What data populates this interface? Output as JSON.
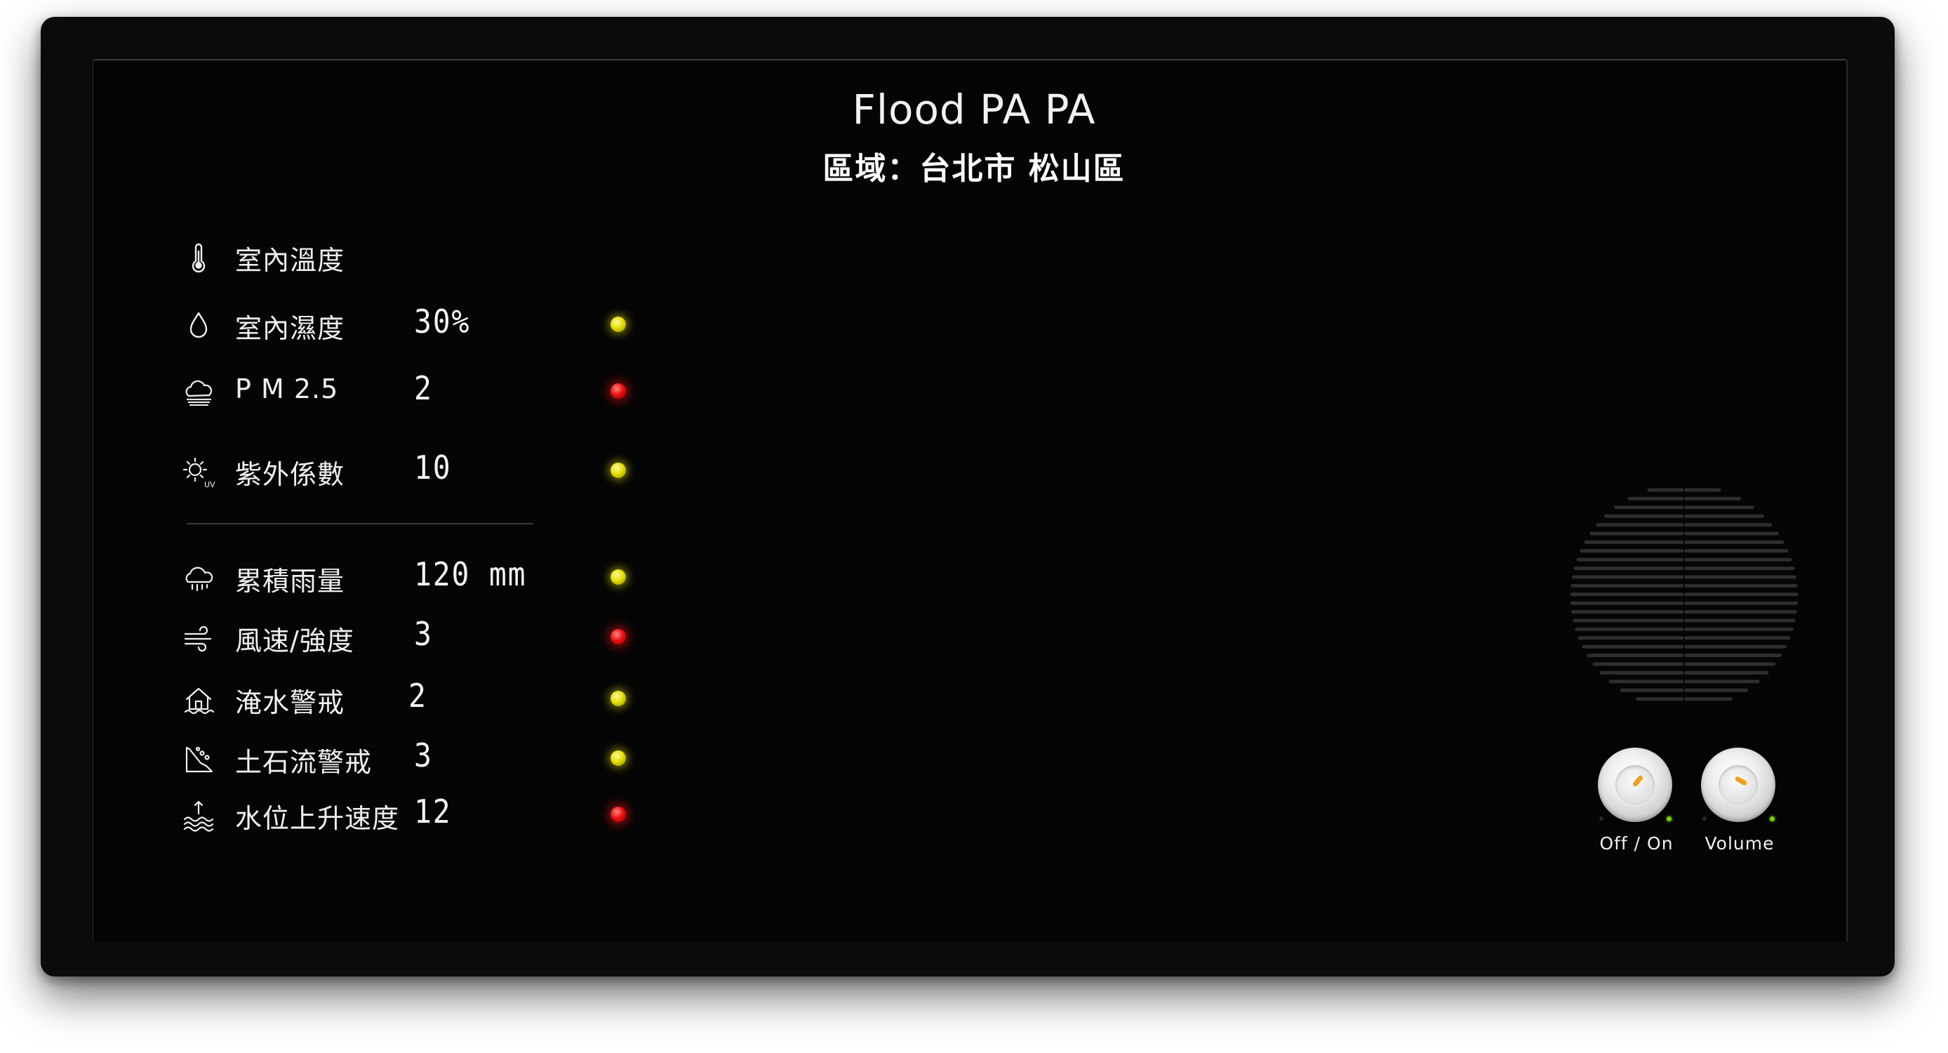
{
  "header": {
    "title": "Flood PA PA",
    "region": "區域：台北市 松山區"
  },
  "readings": [
    {
      "label": "室內溫度",
      "value": "",
      "status": "none",
      "icon": "thermometer-icon"
    },
    {
      "label": "室內濕度",
      "value": "30%",
      "status": "yellow",
      "icon": "droplet-icon"
    },
    {
      "label": "P M 2.5",
      "value": "2",
      "status": "red",
      "icon": "smog-cloud-icon"
    },
    {
      "label": "紫外係數",
      "value": "10",
      "status": "yellow",
      "icon": "uv-sun-icon"
    },
    {
      "label": "累積雨量",
      "value": "120 mm",
      "status": "yellow",
      "icon": "rain-cloud-icon"
    },
    {
      "label": "風速/強度",
      "value": "3",
      "status": "red",
      "icon": "wind-icon"
    },
    {
      "label": "淹水警戒",
      "value": "2",
      "status": "yellow",
      "icon": "flooded-house-icon"
    },
    {
      "label": "土石流警戒",
      "value": "3",
      "status": "yellow",
      "icon": "landslide-icon"
    },
    {
      "label": "水位上升速度",
      "value": "12",
      "status": "red",
      "icon": "water-rise-icon"
    }
  ],
  "controls": {
    "power_label": "Off / On",
    "volume_label": "Volume"
  },
  "colors": {
    "background": "#050505",
    "text": "#f0f0f0",
    "led_yellow": "#e6e000",
    "led_red": "#ee1010",
    "knob_marker": "#f0a020",
    "indicator_green": "#7ad000"
  }
}
